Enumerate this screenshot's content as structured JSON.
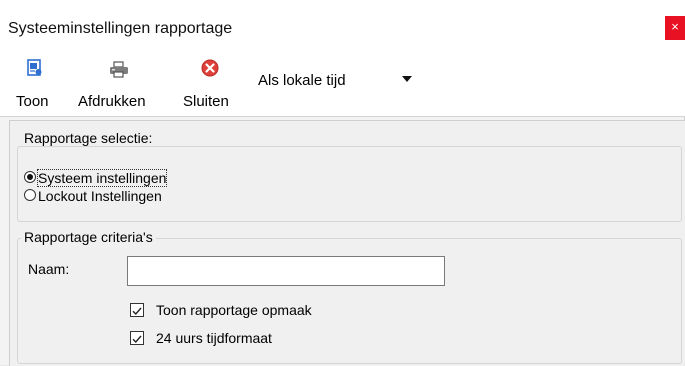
{
  "window": {
    "title": "Systeeminstellingen rapportage",
    "close_glyph": "×"
  },
  "toolbar": {
    "buttons": [
      {
        "label": "Toon",
        "icon": "report-view-icon"
      },
      {
        "label": "Afdrukken",
        "icon": "printer-icon"
      },
      {
        "label": "Sluiten",
        "icon": "close-circle-icon"
      }
    ],
    "timezone": {
      "selected": "Als lokale tijd"
    }
  },
  "selection": {
    "legend": "Rapportage selectie:",
    "options": [
      {
        "label": "Systeem instellingen",
        "checked": true
      },
      {
        "label": "Lockout Instellingen",
        "checked": false
      }
    ]
  },
  "criteria": {
    "legend": "Rapportage criteria's",
    "name_label": "Naam:",
    "name_value": "",
    "show_layout_label": "Toon rapportage opmaak",
    "show_layout_checked": true,
    "hour24_label": "24 uurs tijdformaat",
    "hour24_checked": true
  },
  "colors": {
    "close": "#e81123",
    "icon_blue": "#2e6fd0",
    "icon_red": "#e0403a"
  }
}
